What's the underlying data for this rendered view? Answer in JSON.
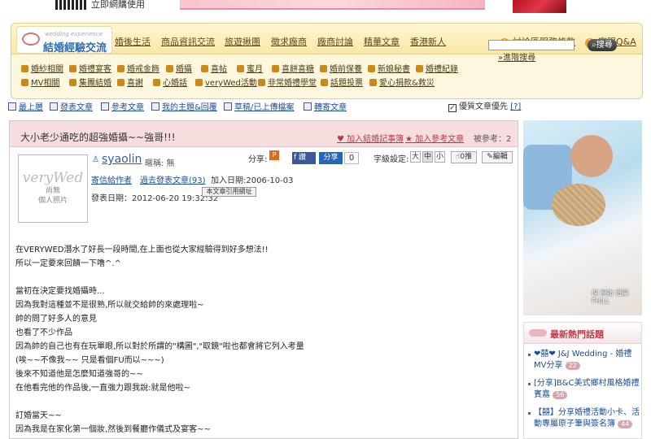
{
  "top": {
    "note": "立即網購使用"
  },
  "logo": {
    "en": "wedding experience",
    "title": "結婚經驗交流"
  },
  "main_tabs": [
    "婚後生活",
    "商品資訊交流",
    "旅遊揪團",
    "徵求廠商",
    "廠商討論",
    "精華文章",
    "香港新人"
  ],
  "right_links": [
    "討論區服務條款",
    "客服Q&A"
  ],
  "sub_nav": [
    [
      "婚紗相關",
      "婚禮宴客",
      "婚戒金飾",
      "婚攝",
      "喜帖",
      "蜜月",
      "喜餅喜糖",
      "婚前保養",
      "新娘秘書",
      "婚禮紀錄"
    ],
    [
      "MV相關",
      "集團結婚",
      "喜謝",
      "心婚話",
      "veryWed活動",
      "非常婚禮學堂",
      "話題投票",
      "愛心捐款&救災"
    ]
  ],
  "search": {
    "button": "搜尋",
    "advanced": "»進階搜尋"
  },
  "toolbar": [
    "最上層",
    "發表文章",
    "參考文章",
    "我的主題&回覆",
    "草稿/已上傳檔案",
    "轉寄文章"
  ],
  "pref_check": "優質文章優先",
  "pref_help": "[?]",
  "post": {
    "title": "大小老少通吃的超強婚攝~~強哥!!!",
    "add_record": "加入結婚記事簿",
    "add_ref": "加入參考文章",
    "fav_count": "被參考：2",
    "avatar_logo": "veryWed",
    "avatar_text1": "尚無",
    "avatar_text2": "個人照片",
    "author": "syaolin",
    "nickname": "暱稱: 無",
    "link_contact": "寄信給作者",
    "link_past": "過去發表文章(93)",
    "joined": "加入日期:2006-10-03",
    "post_date": "發表日期：2012-06-20 19:32:32",
    "cite_btn": "本文章引用網址",
    "share_label": "分享:",
    "fb_label": "讚",
    "share_btn": "分享",
    "share_count": "0",
    "font_label": "字級設定:",
    "font_sizes": [
      "大",
      "中",
      "小"
    ],
    "push_btn": "0推",
    "edit_btn": "編輯",
    "body": [
      "在VERYWED潛水了好長一段時間,在上面也從大家經驗得到好多想法!!",
      "所以一定要來回饋一下噜^.^",
      "",
      "當初在決定要找婚攝時...",
      "因為我對這種並不是很熟,所以就交給帥的來處理啦~",
      "帥的問了好多人的意見",
      "也看了不少作品",
      "因為帥的自己也有在玩單眼,所以對於所謂的\"構圖\",\"取鏡\"啦也都會將它列入考量",
      "(唉~~不像我~~ 只是看個FU而以~~~)",
      "後來不知道他是怎麼知道強哥的~~",
      "在他看完他的作品後,一直強力跟我說:就是他啦~",
      "",
      "訂婚當天~~",
      "因為我是在家化第一個妝,然後到餐廳作儀式及宴客~~"
    ]
  },
  "photo_caption": [
    "倪 國強 婚攝",
    "PHILL"
  ],
  "hot": {
    "title": "最新熱門話題",
    "items": [
      {
        "text": "❤囍❤ J&J Wedding - 婚禮MV分享",
        "count": "22"
      },
      {
        "text": "[分享]B&C美式鄉村風格婚禮賓嘉",
        "count": "56"
      },
      {
        "text": "【囍】分享婚禮活動小卡、活動專屬原子筆與簽名簿",
        "count": "44"
      }
    ]
  },
  "colors": {
    "accent": "#c23b4b",
    "link": "#1a4d99",
    "nav_bg": "#fdf7df",
    "title_bg": "#f6dedf"
  }
}
